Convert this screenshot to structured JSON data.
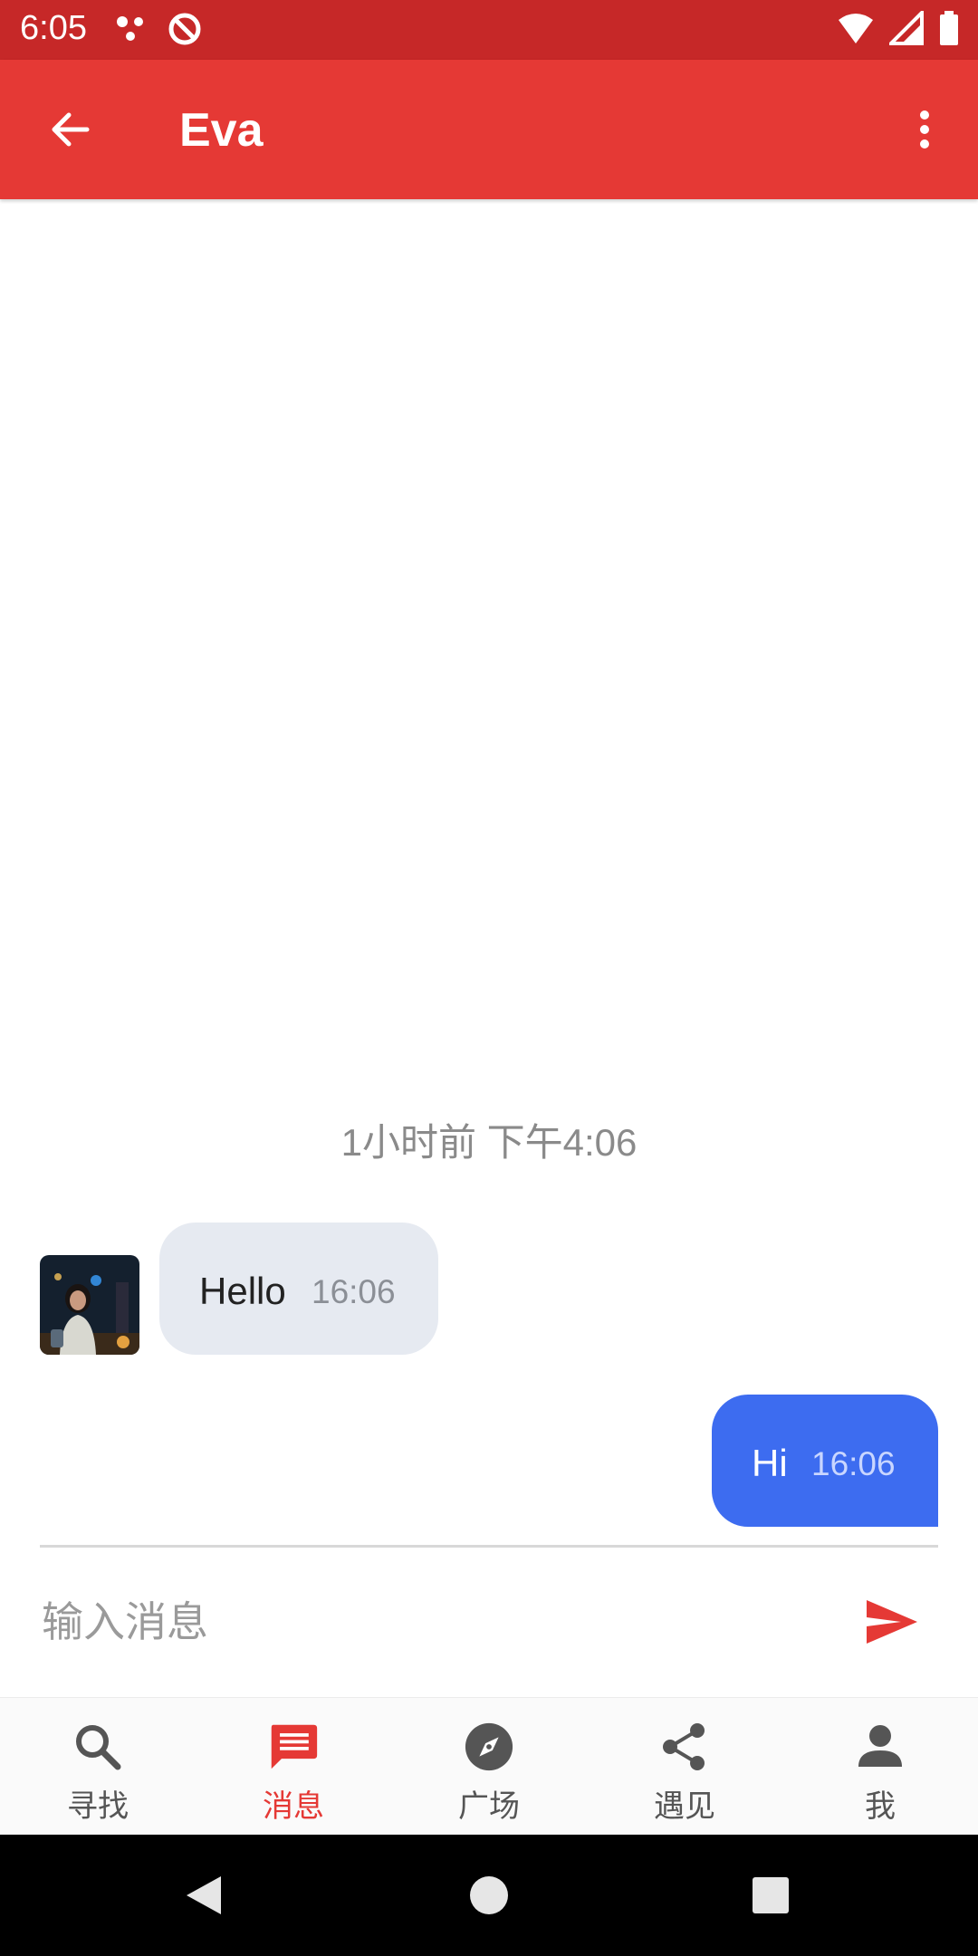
{
  "status_bar": {
    "time": "6:05"
  },
  "app_bar": {
    "title": "Eva"
  },
  "chat": {
    "time_divider": "1小时前 下午4:06",
    "messages": [
      {
        "direction": "incoming",
        "text": "Hello",
        "time": "16:06"
      },
      {
        "direction": "outgoing",
        "text": "Hi",
        "time": "16:06"
      }
    ]
  },
  "composer": {
    "placeholder": "输入消息"
  },
  "bottom_nav": {
    "items": [
      {
        "label": "寻找",
        "icon": "search-icon",
        "active": false
      },
      {
        "label": "消息",
        "icon": "message-icon",
        "active": true
      },
      {
        "label": "广场",
        "icon": "compass-icon",
        "active": false
      },
      {
        "label": "遇见",
        "icon": "share-icon",
        "active": false
      },
      {
        "label": "我",
        "icon": "person-icon",
        "active": false
      }
    ]
  },
  "colors": {
    "status_bar": "#c62828",
    "app_bar": "#e53935",
    "incoming_bubble": "#e6eaf1",
    "outgoing_bubble": "#3d6cf0",
    "active_nav": "#e53935"
  }
}
